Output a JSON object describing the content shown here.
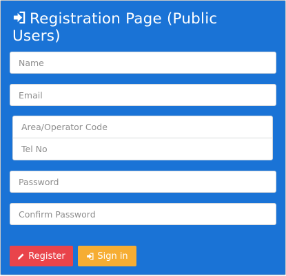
{
  "header": {
    "icon": "sign-in-icon",
    "title": "Registration Page (Public Users)"
  },
  "form": {
    "name": {
      "placeholder": "Name",
      "value": ""
    },
    "email": {
      "placeholder": "Email",
      "value": ""
    },
    "area_code": {
      "placeholder": "Area/Operator Code",
      "value": ""
    },
    "tel_no": {
      "placeholder": "Tel No",
      "value": ""
    },
    "password": {
      "placeholder": "Password",
      "value": ""
    },
    "confirm_password": {
      "placeholder": "Confirm Password",
      "value": ""
    }
  },
  "buttons": {
    "register": {
      "label": "Register",
      "icon": "pencil-icon",
      "color": "#e9444b"
    },
    "signin": {
      "label": "Sign in",
      "icon": "sign-in-icon",
      "color": "#f6ad33"
    }
  },
  "colors": {
    "panel_background": "#1a73d6",
    "title_text": "#ffffff"
  }
}
